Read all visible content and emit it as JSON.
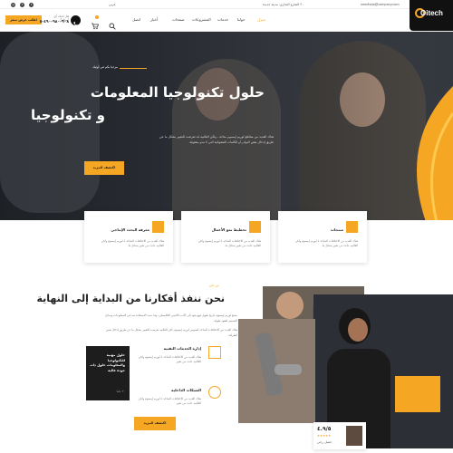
{
  "topbar": {
    "email": "needhelp@company.com",
    "address": "٣٠ الشارع التجاري، مدينة جديدة",
    "lang": "عربي"
  },
  "header": {
    "logo_text": "Oitech",
    "nav_items": [
      "منزل",
      "حولنا",
      "خدمات",
      "المشروعات",
      "صفحات",
      "أخبار",
      "اتصل"
    ],
    "phone_label": "هل لديك أي أسئلة؟",
    "phone_number": "٩٠٨-٩٨٠-٤٩٠-٥",
    "cta_label": "اطلب عرض سعر"
  },
  "hero": {
    "badge": "مرحبا بكم في أوتيك",
    "title_line1": "حلول تكنولوجيا المعلومات",
    "title_line2": "و تكنولوجيا",
    "description": "هناك العديد من مقاطع لوريم إيبسوم متاحة ، ولكن الغالبية قد تعرضت للتغيير بشكل ما عن طريق إدخال بعض النوادر أو الكلمات العشوائية التي لا تبدو معقولة.",
    "button_label": "اكتشف المزيد"
  },
  "cards": [
    {
      "title": "منتجات",
      "description": "هناك العديد من الاختلافات المتاحة لـ لوريم إيبسوم ولكن الغالبية عانت من تغيير بشكل ما."
    },
    {
      "title": "تخطيط نمو الأعمال",
      "description": "هناك العديد من الاختلافات المتاحة لـ لوريم إيبسوم ولكن الغالبية عانت من تغيير بشكل ما."
    },
    {
      "title": "معرفة البحث الإنتاجي",
      "description": "هناك العديد من الاختلافات المتاحة لـ لوريم إيبسوم ولكن الغالبية عانت من تغيير بشكل ما."
    }
  ],
  "about": {
    "tag": "من نحن",
    "title": "نحن ننفذ أفكارنا من البداية إلى النهاية",
    "para1": "يتمتع لوريم إيبسوم بتاريخ طويل فهو يعود إلى الأدب اللاتيني الكلاسيكي، وقد تمت الاستفادة منه في المطبوعات ونماذج التصميم لعقود طويلة.",
    "para2": "هناك العديد من الاختلافات المتاحة لنصوص لوريم إيبسوم، لكن الغالبية تعرضت للتغيير بشكل ما عن طريق إدخال بعض الطرافة.",
    "dark_box_text": "حلول مهنية للتكنولوجيا والمعلومات حلول ذات جودة عالية",
    "dark_box_sub": "٣٠ عاما",
    "features": [
      {
        "title": "إدارة الخدمات التقنية",
        "description": "هناك العديد من الاختلافات المتاحة لـ لوريم إيبسوم ولكن الغالبية عانت من تغيير"
      },
      {
        "title": "الشبكات الداخلية",
        "description": "هناك العديد من الاختلافات المتاحة لـ لوريم إيبسوم ولكن الغالبية عانت من تغيير"
      }
    ],
    "button_label": "اكتشف المزيد",
    "testimonial_name": "جميل رجي",
    "rating": "٤.٩/٥"
  },
  "colors": {
    "accent": "#f5a623",
    "dark": "#1d1d1d"
  }
}
